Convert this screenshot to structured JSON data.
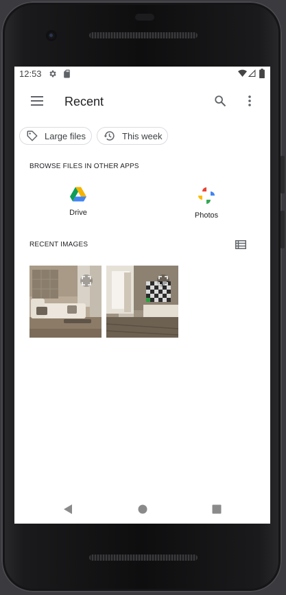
{
  "status_bar": {
    "time": "12:53"
  },
  "app_bar": {
    "title": "Recent"
  },
  "chips": [
    {
      "label": "Large files",
      "icon": "tag-icon"
    },
    {
      "label": "This week",
      "icon": "history-icon"
    }
  ],
  "browse": {
    "heading": "BROWSE FILES IN OTHER APPS",
    "apps": [
      {
        "label": "Drive",
        "icon": "drive-icon"
      },
      {
        "label": "Photos",
        "icon": "photos-icon"
      }
    ]
  },
  "recent_images": {
    "heading": "RECENT IMAGES",
    "view_icon": "list-view-icon"
  },
  "colors": {
    "accent_blue": "#4285F4",
    "accent_green": "#0F9D58",
    "accent_yellow": "#F4B400",
    "accent_red": "#DB4437"
  }
}
